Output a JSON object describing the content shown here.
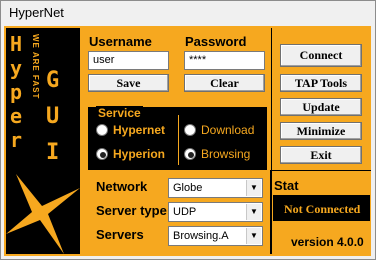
{
  "window": {
    "title": "HyperNet"
  },
  "logo": {
    "tagline": "WE ARE FAST",
    "left_letters": [
      "H",
      "y",
      "p",
      "e",
      "r"
    ],
    "right_letters": [
      "G",
      "U",
      "I"
    ]
  },
  "login": {
    "username_label": "Username",
    "password_label": "Password",
    "username_value": "user",
    "password_value": "****",
    "save_label": "Save",
    "clear_label": "Clear"
  },
  "service": {
    "legend": "Service",
    "options": [
      {
        "label": "Hypernet",
        "selected": false
      },
      {
        "label": "Hyperion",
        "selected": true
      },
      {
        "label": "Download",
        "selected": false
      },
      {
        "label": "Browsing",
        "selected": true
      }
    ]
  },
  "settings": {
    "network_label": "Network",
    "network_value": "Globe",
    "server_type_label": "Server type",
    "server_type_value": "UDP",
    "servers_label": "Servers",
    "servers_value": "Browsing.A"
  },
  "actions": {
    "connect": "Connect",
    "tap_tools": "TAP Tools",
    "update": "Update",
    "minimize": "Minimize",
    "exit": "Exit"
  },
  "status": {
    "label": "Stat",
    "value": "Not Connected",
    "version": "version 4.0.0"
  },
  "colors": {
    "accent": "#f6a81f",
    "panel": "#000000",
    "status_text": "#f6a81f"
  }
}
